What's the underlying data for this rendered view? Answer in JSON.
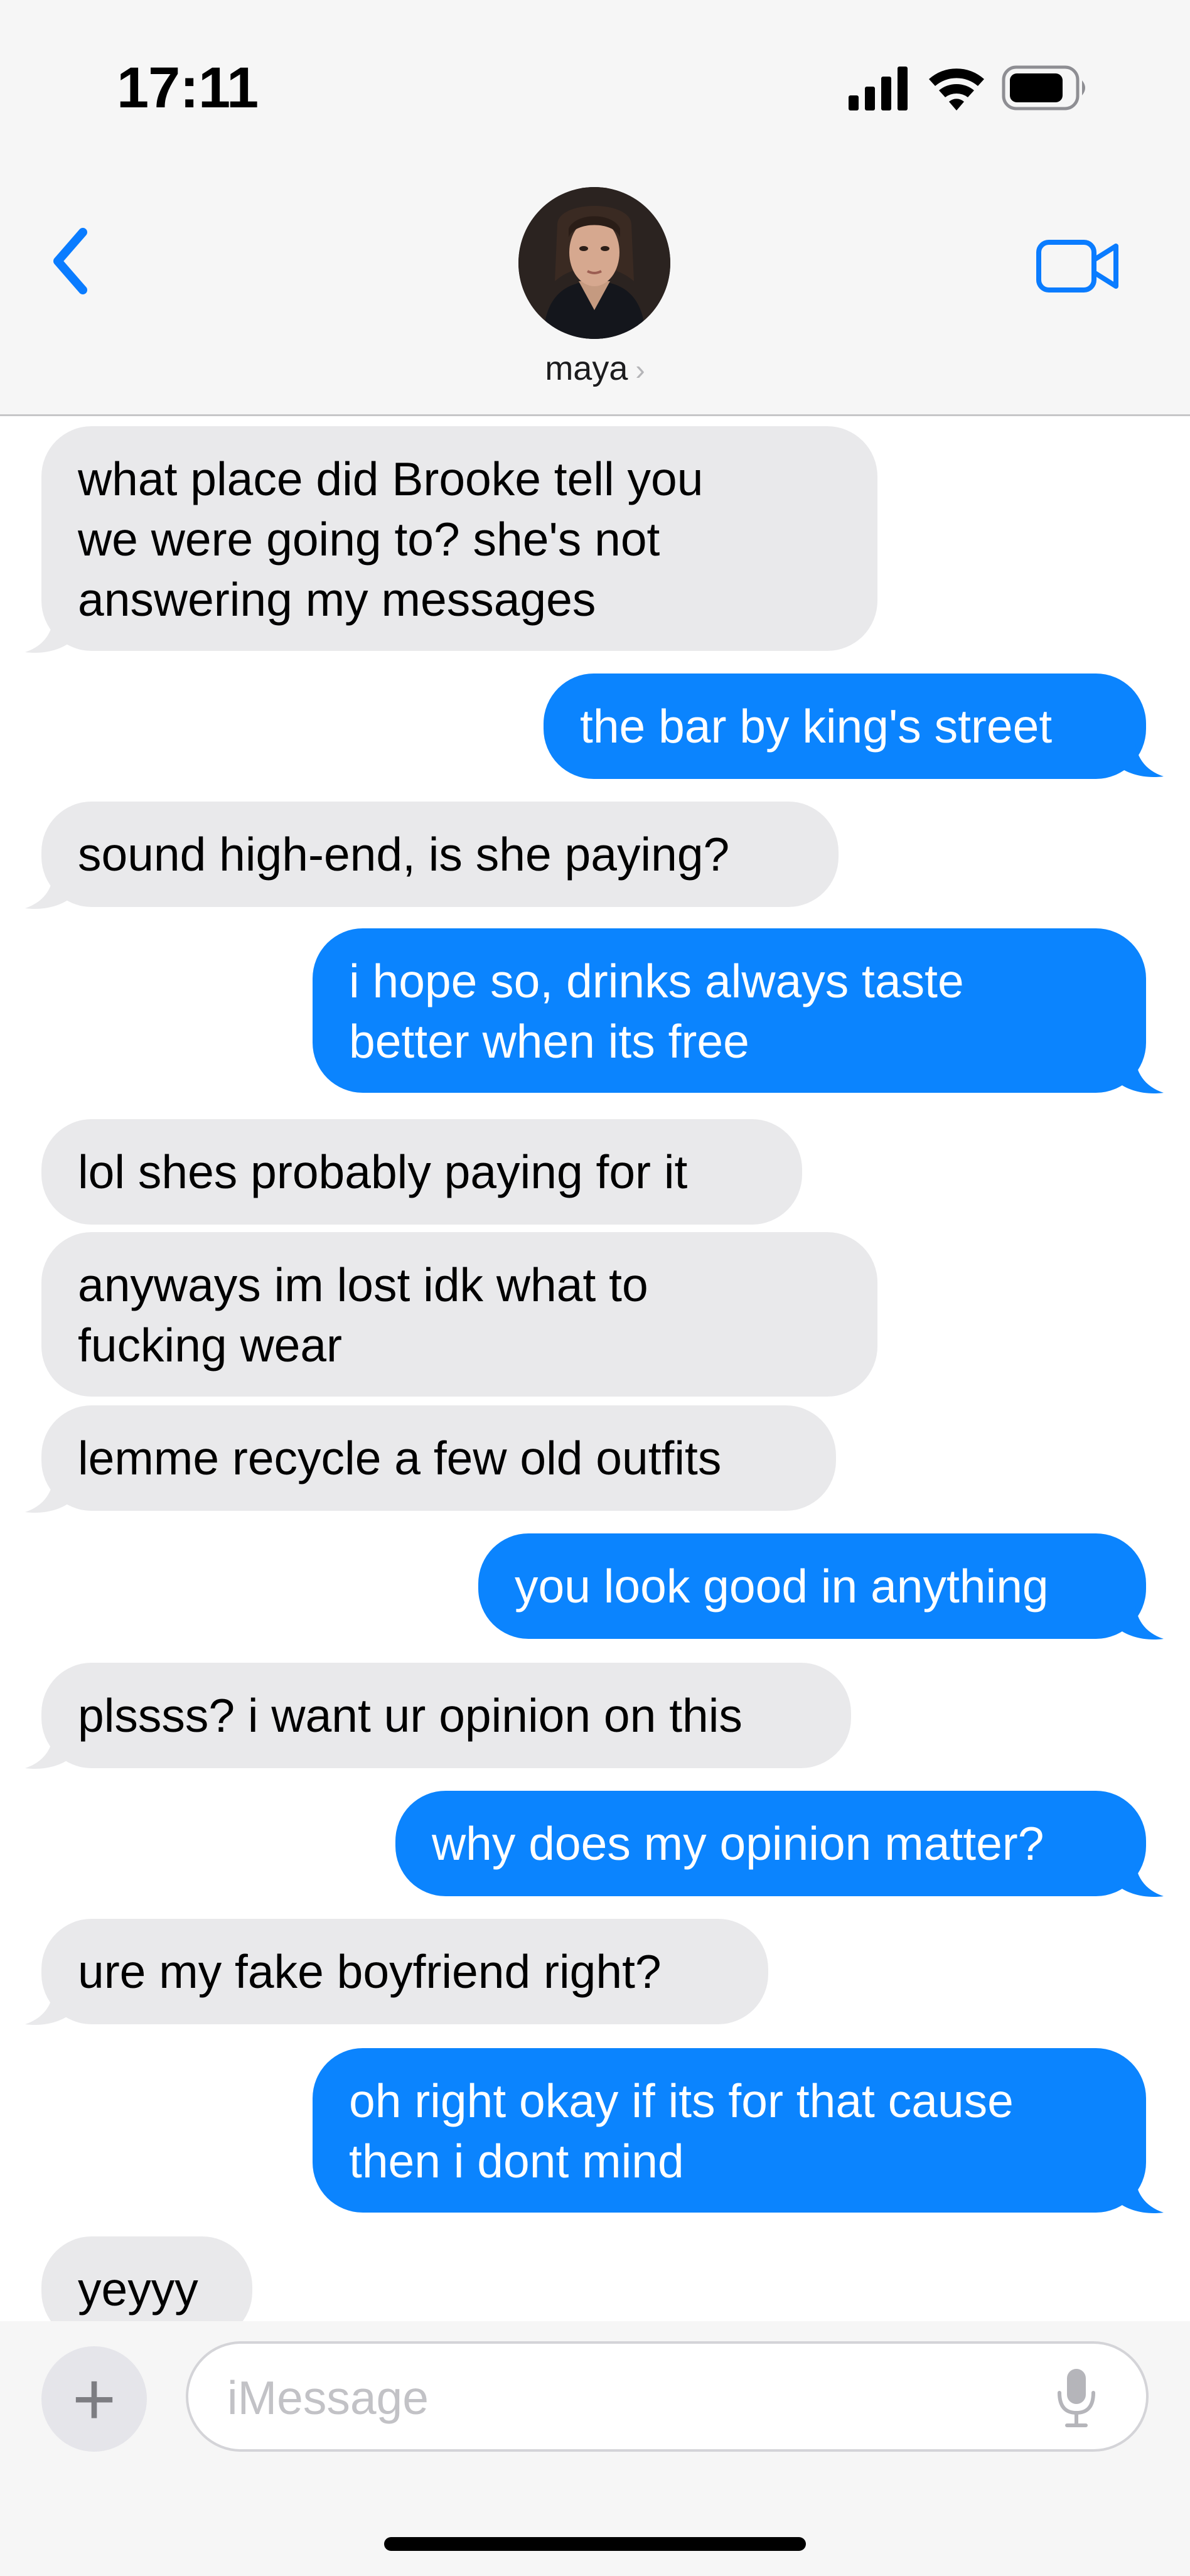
{
  "status": {
    "time": "17:11"
  },
  "header": {
    "contact_name": "maya"
  },
  "messages": [
    {
      "from": "them",
      "text": "what place did Brooke tell you\nwe were going to? she's not\nanswering my messages"
    },
    {
      "from": "me",
      "text": "the bar by king's street"
    },
    {
      "from": "them",
      "text": "sound high-end, is she paying?"
    },
    {
      "from": "me",
      "text": "i hope so, drinks always taste\nbetter when its free"
    },
    {
      "from": "them",
      "text": "lol shes probably paying for it"
    },
    {
      "from": "them",
      "text": "anyways im lost idk what to\nfucking wear"
    },
    {
      "from": "them",
      "text": "lemme recycle a few old outfits"
    },
    {
      "from": "me",
      "text": "you look good in anything"
    },
    {
      "from": "them",
      "text": "plssss? i want ur opinion on this"
    },
    {
      "from": "me",
      "text": "why does my opinion matter?"
    },
    {
      "from": "them",
      "text": "ure my fake boyfriend right?"
    },
    {
      "from": "me",
      "text": "oh right okay if its for that cause\nthen i dont mind"
    },
    {
      "from": "them",
      "text": "yeyyy"
    }
  ],
  "input": {
    "placeholder": "iMessage",
    "value": ""
  },
  "icons": {
    "back": "chevron-left-icon",
    "video": "video-camera-icon",
    "add": "plus-icon",
    "mic": "microphone-icon"
  },
  "colors": {
    "outgoing": "#0b84fe",
    "incoming": "#e9e9eb",
    "accent": "#0a7cff"
  }
}
